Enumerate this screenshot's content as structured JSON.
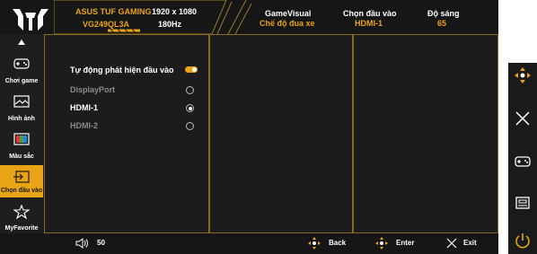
{
  "header": {
    "brand": "ASUS TUF GAMING",
    "model": "VG249QL3A",
    "resolution": "1920 x 1080",
    "refresh": "180Hz",
    "gamevisual_label": "GameVisual",
    "gamevisual_value": "Chế độ đua xe",
    "input_label": "Chọn đầu vào",
    "input_value": "HDMI-1",
    "brightness_label": "Độ sáng",
    "brightness_value": "65"
  },
  "sidebar": {
    "items": [
      {
        "label": "Chơi game",
        "icon": "gamepad-icon"
      },
      {
        "label": "Hình ảnh",
        "icon": "image-icon"
      },
      {
        "label": "Màu sắc",
        "icon": "color-icon"
      },
      {
        "label": "Chọn đầu vào",
        "icon": "input-icon"
      },
      {
        "label": "MyFavorite",
        "icon": "star-icon"
      }
    ],
    "active_index": 3
  },
  "menu": {
    "auto_detect_label": "Tự động phát hiện đầu vào",
    "auto_detect_on": true,
    "options": [
      {
        "label": "DisplayPort",
        "selected": false,
        "enabled": false
      },
      {
        "label": "HDMI-1",
        "selected": true,
        "enabled": true
      },
      {
        "label": "HDMI-2",
        "selected": false,
        "enabled": false
      }
    ]
  },
  "footer": {
    "volume": "50",
    "back_label": "Back",
    "enter_label": "Enter",
    "exit_label": "Exit"
  },
  "colors": {
    "accent": "#e8a317",
    "background": "#1a1a1a",
    "text": "#ffffff",
    "disabled": "#8a8a8a"
  }
}
